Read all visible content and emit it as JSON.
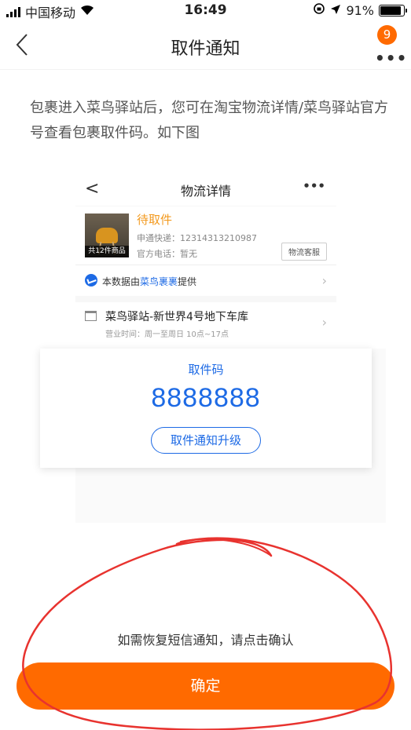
{
  "status_bar": {
    "carrier": "中国移动",
    "time": "16:49",
    "battery": "91%",
    "battery_level": 0.91
  },
  "nav": {
    "title": "取件通知",
    "badge": "9",
    "back_icon": "chevron-left-icon",
    "more_icon": "more-dots-icon"
  },
  "intro": "包裹进入菜鸟驿站后，您可在淘宝物流详情/菜鸟驿站官方号查看包裹取件码。如下图",
  "example": {
    "nav_title": "物流详情",
    "package": {
      "status": "待取件",
      "thumb_label": "共12件商品",
      "tracking": "申通快递：12314313210987",
      "phone": "官方电话：暂无",
      "service_button": "物流客服"
    },
    "source": {
      "prefix": "本数据由",
      "highlight": "菜鸟裹裹",
      "suffix": "提供"
    },
    "station": {
      "name": "菜鸟驿站-新世界4号地下车库",
      "hours": "营业时间：周一至周日 10点~17点"
    },
    "code_label": "取件码",
    "code_value": "8888888",
    "upgrade_button": "取件通知升级"
  },
  "hint": "如需恢复短信通知，请点击确认",
  "confirm_button": "确定",
  "colors": {
    "accent": "#ff6a00",
    "blue": "#1d6ae5",
    "annotation": "#e8332f"
  }
}
